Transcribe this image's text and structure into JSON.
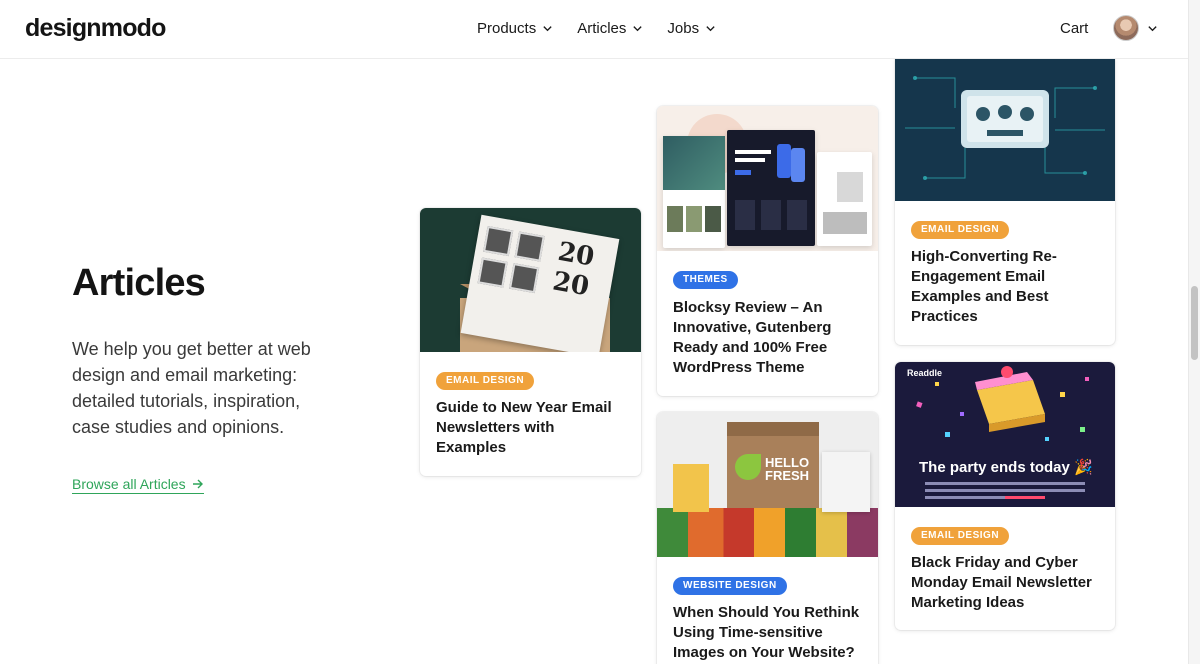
{
  "header": {
    "logo": "designmodo",
    "nav": [
      {
        "label": "Products"
      },
      {
        "label": "Articles"
      },
      {
        "label": "Jobs"
      }
    ],
    "cart": "Cart"
  },
  "intro": {
    "title": "Articles",
    "description": "We help you get better at web design and email marketing: detailed tutorials, inspiration, case studies and opinions.",
    "browse_link": "Browse all Articles"
  },
  "cards": {
    "newyear": {
      "badge": "EMAIL DESIGN",
      "title": "Guide to New Year Email Newsletters with Examples",
      "image_text_top": "20",
      "image_text_bottom": "20"
    },
    "blocksy": {
      "badge": "THEMES",
      "title": "Blocksy Review – An Innovative, Gutenberg Ready and 100% Free WordPress Theme"
    },
    "fresh": {
      "badge": "WEBSITE DESIGN",
      "title": "When Should You Rethink Using Time-sensitive Images on Your Website?",
      "brand_line1": "HELLO",
      "brand_line2": "FRESH"
    },
    "reengage": {
      "badge": "EMAIL DESIGN",
      "title": "High-Converting Re-Engagement Email Examples and Best Practices"
    },
    "party": {
      "badge": "EMAIL DESIGN",
      "title": "Black Friday and Cyber Monday Email Newsletter Marketing Ideas",
      "image_brand": "Readdle",
      "image_headline": "The party ends today",
      "image_emoji": "🎉"
    }
  },
  "colors": {
    "badge_email": "#f0a23b",
    "badge_themes": "#2f72e6",
    "link_green": "#2fa55a"
  }
}
